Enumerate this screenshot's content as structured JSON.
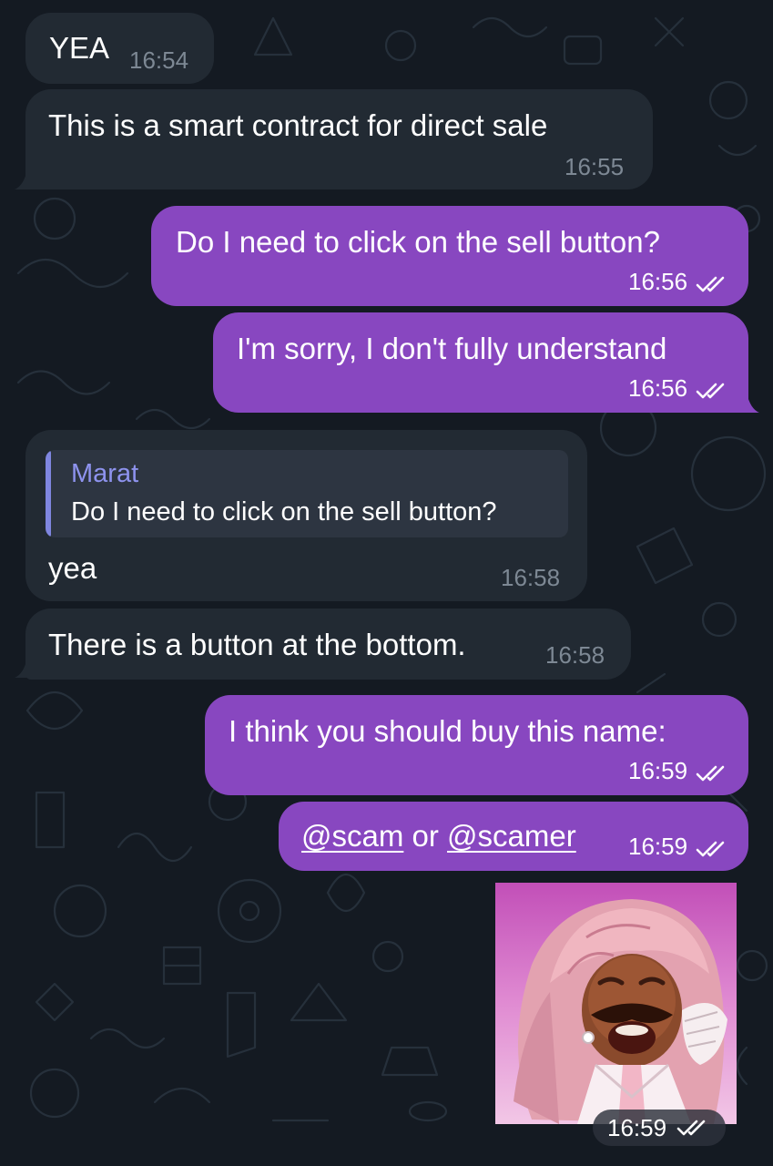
{
  "colors": {
    "background": "#141a22",
    "incoming_bubble": "#222a33",
    "outgoing_bubble": "#8847c0",
    "reply_name": "#8e93ee",
    "reply_bar": "#7f86e0"
  },
  "messages": [
    {
      "direction": "incoming",
      "text": "YEA",
      "time": "16:54"
    },
    {
      "direction": "incoming",
      "text": "This is a smart contract for direct sale",
      "time": "16:55"
    },
    {
      "direction": "outgoing",
      "text": "Do I need to click on the sell button?",
      "time": "16:56",
      "status_icon": "double-check-icon"
    },
    {
      "direction": "outgoing",
      "text": "I'm sorry, I don't fully understand",
      "time": "16:56",
      "status_icon": "double-check-icon"
    },
    {
      "direction": "incoming",
      "reply_to": {
        "name": "Marat",
        "text": "Do I need to click on the sell button?"
      },
      "text": "yea",
      "time": "16:58"
    },
    {
      "direction": "incoming",
      "text": "There is a button at the bottom.",
      "time": "16:58"
    },
    {
      "direction": "outgoing",
      "text": "I think you should buy this name:",
      "time": "16:59",
      "status_icon": "double-check-icon"
    },
    {
      "direction": "outgoing",
      "mention1": "@scam",
      "connector": "or",
      "mention2": "@scamer",
      "time": "16:59",
      "status_icon": "double-check-icon"
    },
    {
      "direction": "outgoing",
      "type": "sticker",
      "time": "16:59",
      "status_icon": "double-check-icon"
    }
  ]
}
